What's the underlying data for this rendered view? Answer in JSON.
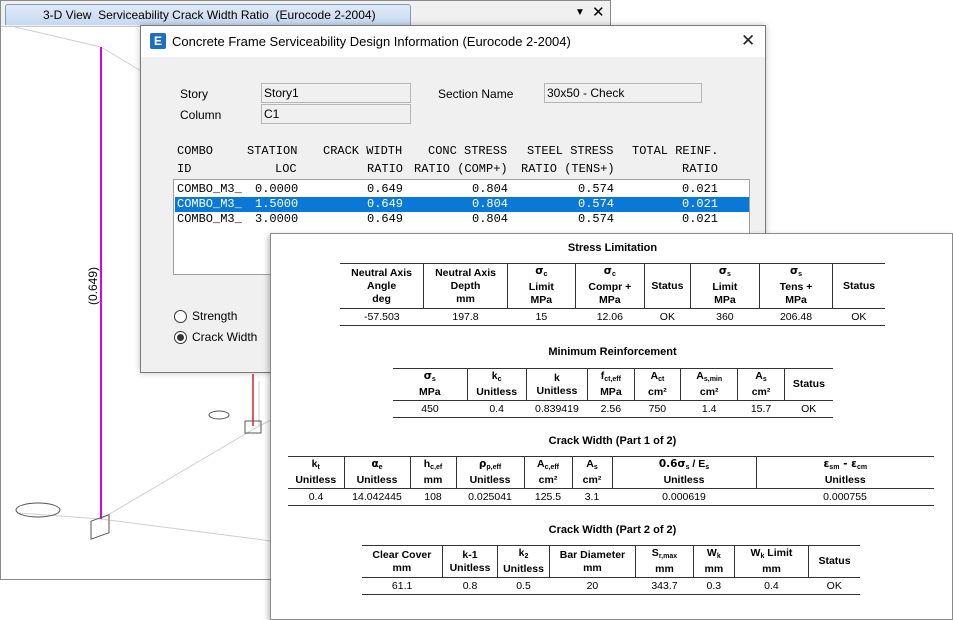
{
  "view_window": {
    "tab_title": "3-D View  Serviceability Crack Width Ratio  (Eurocode 2-2004)",
    "member_label": "(0.649)",
    "menu_icon": "chevron-down-icon",
    "close_icon": "close-icon"
  },
  "dialog": {
    "title": "Concrete Frame Serviceability Design Information (Eurocode 2-2004)",
    "app_icon_letter": "E",
    "story_label": "Story",
    "story_value": "Story1",
    "column_label": "Column",
    "column_value": "C1",
    "section_name_label": "Section Name",
    "section_name_value": "30x50 - Check",
    "table_headers": {
      "line1": [
        "COMBO",
        "STATION",
        "CRACK WIDTH",
        "CONC STRESS",
        "STEEL STRESS",
        "TOTAL REINF."
      ],
      "line2": [
        "ID",
        "LOC",
        "RATIO",
        "RATIO (COMP+)",
        "RATIO (TENS+)",
        "RATIO"
      ]
    },
    "rows": [
      {
        "combo": "COMBO_M3_",
        "station": "0.0000",
        "crack": "0.649",
        "conc": "0.804",
        "steel": "0.574",
        "reinf": "0.021"
      },
      {
        "combo": "COMBO_M3_",
        "station": "1.5000",
        "crack": "0.649",
        "conc": "0.804",
        "steel": "0.574",
        "reinf": "0.021"
      },
      {
        "combo": "COMBO_M3_",
        "station": "3.0000",
        "crack": "0.649",
        "conc": "0.804",
        "steel": "0.574",
        "reinf": "0.021"
      }
    ],
    "selected_row_index": 1,
    "radio_strength": "Strength",
    "radio_crack_width": "Crack Width",
    "selected_radio": "Crack Width"
  },
  "report": {
    "stress_limitation": {
      "title": "Stress Limitation",
      "headers": {
        "na_angle": [
          "Neutral Axis",
          "Angle",
          "deg"
        ],
        "na_depth": [
          "Neutral Axis",
          "Depth",
          "mm"
        ],
        "sc_limit": [
          "σ",
          "c",
          "Limit",
          "MPa"
        ],
        "sc_comp": [
          "σ",
          "c",
          "Compr +",
          "MPa"
        ],
        "status1": "Status",
        "ss_limit": [
          "σ",
          "s",
          "Limit",
          "MPa"
        ],
        "ss_tens": [
          "σ",
          "s",
          "Tens +",
          "MPa"
        ],
        "status2": "Status"
      },
      "values": [
        "-57.503",
        "197.8",
        "15",
        "12.06",
        "OK",
        "360",
        "206.48",
        "OK"
      ]
    },
    "minimum_reinforcement": {
      "title": "Minimum Reinforcement",
      "headers": {
        "ss": [
          "σ",
          "s",
          "MPa"
        ],
        "kc": [
          "k",
          "c",
          "Unitless"
        ],
        "k": [
          "k",
          "Unitless"
        ],
        "fct": [
          "f",
          "ct,eff",
          "MPa"
        ],
        "act": [
          "A",
          "ct",
          "cm²"
        ],
        "asmin": [
          "A",
          "s,min",
          "cm²"
        ],
        "as": [
          "A",
          "s",
          "cm²"
        ],
        "status": "Status"
      },
      "values": [
        "450",
        "0.4",
        "0.839419",
        "2.56",
        "750",
        "1.4",
        "15.7",
        "OK"
      ]
    },
    "crack_width_1": {
      "title": "Crack Width (Part 1 of 2)",
      "headers": {
        "kt": [
          "k",
          "t",
          "Unitless"
        ],
        "ae": [
          "α",
          "e",
          "Unitless"
        ],
        "hc": [
          "h",
          "c,ef",
          "mm"
        ],
        "rho": [
          "ρ",
          "p,eff",
          "Unitless"
        ],
        "acef": [
          "A",
          "c,eff",
          "cm²"
        ],
        "as": [
          "A",
          "s",
          "cm²"
        ],
        "ratio": [
          "0.6σ",
          "s",
          " / E",
          "s",
          "Unitless"
        ],
        "eps": [
          "ε",
          "sm",
          " - ε",
          "cm",
          "Unitless"
        ]
      },
      "values": [
        "0.4",
        "14.042445",
        "108",
        "0.025041",
        "125.5",
        "3.1",
        "0.000619",
        "0.000755"
      ]
    },
    "crack_width_2": {
      "title": "Crack Width (Part 2 of 2)",
      "headers": {
        "cover": [
          "Clear Cover",
          "mm"
        ],
        "k1": [
          "k-1",
          "Unitless"
        ],
        "k2": [
          "k",
          "2",
          "Unitless"
        ],
        "bar": [
          "Bar Diameter",
          "mm"
        ],
        "srmax": [
          "S",
          "r,max",
          "mm"
        ],
        "wk": [
          "W",
          "k",
          "mm"
        ],
        "wklim": [
          "W",
          "k",
          " Limit",
          "mm"
        ],
        "status": "Status"
      },
      "values": [
        "61.1",
        "0.8",
        "0.5",
        "20",
        "343.7",
        "0.3",
        "0.4",
        "OK"
      ]
    }
  },
  "colors": {
    "selection": "#0a78d7",
    "column_member": "#e000e0",
    "beam_member": "#e02020",
    "tab_active": "#c7d9f0"
  }
}
